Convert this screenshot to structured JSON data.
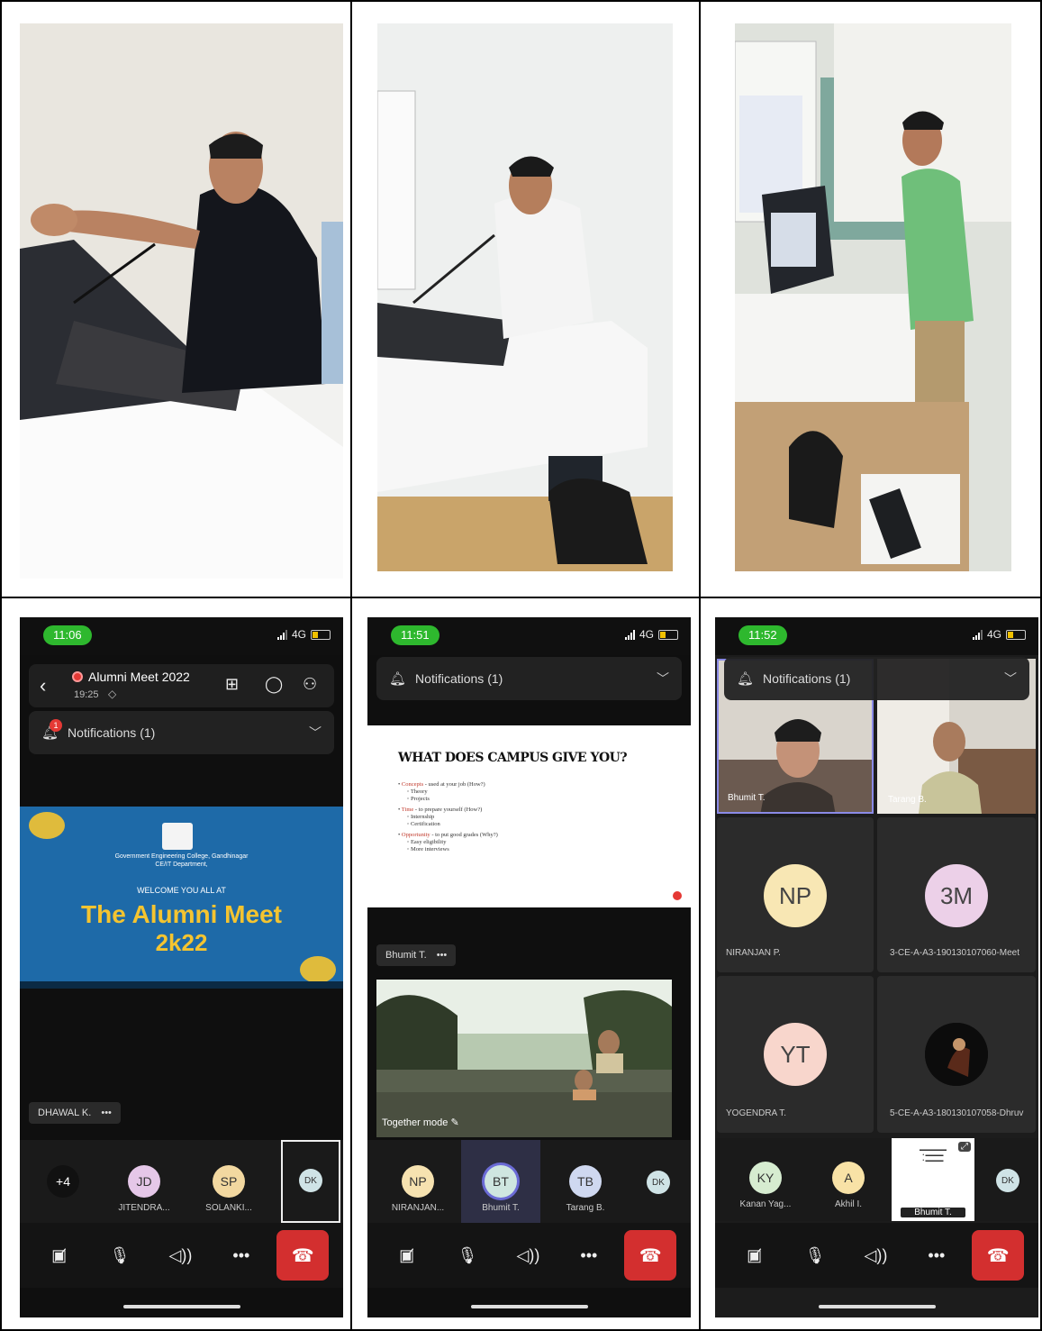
{
  "phones": {
    "p1": {
      "time": "11:06",
      "network": "4G",
      "meeting_title": "Alumni Meet 2022",
      "meeting_duration": "19:25",
      "notifications": "Notifications (1)",
      "notif_count": "1",
      "banner": {
        "college": "Government Engineering College, Gandhinagar",
        "dept": "CE/IT Department,",
        "welcome": "WELCOME YOU ALL AT",
        "title": "The Alumni Meet",
        "year": "2k22"
      },
      "speaker_tag": "DHAWAL K.",
      "more": "•••",
      "participants": [
        {
          "initials": "+4",
          "name": ""
        },
        {
          "initials": "JD",
          "name": "JITENDRA..."
        },
        {
          "initials": "SP",
          "name": "SOLANKI..."
        },
        {
          "initials": "DK",
          "name": ""
        }
      ]
    },
    "p2": {
      "time": "11:51",
      "network": "4G",
      "notifications": "Notifications (1)",
      "slide": {
        "heading": "WHAT DOES CAMPUS GIVE YOU?",
        "items": [
          {
            "key": "Concepts",
            "text": " - used at your job (How?)",
            "subs": [
              "Theory",
              "Projects"
            ]
          },
          {
            "key": "Time",
            "text": " - to prepare yourself (How?)",
            "subs": [
              "Internship",
              "Certification"
            ]
          },
          {
            "key": "Opportunity",
            "text": " - to put good grades (Why?)",
            "subs": [
              "Easy eligibility",
              "More interviews"
            ]
          }
        ]
      },
      "speaker_tag": "Bhumit T.",
      "more": "•••",
      "together_mode": "Together mode",
      "participants": [
        {
          "initials": "NP",
          "name": "NIRANJAN..."
        },
        {
          "initials": "BT",
          "name": "Bhumit T."
        },
        {
          "initials": "TB",
          "name": "Tarang B."
        },
        {
          "initials": "DK",
          "name": ""
        }
      ]
    },
    "p3": {
      "time": "11:52",
      "network": "4G",
      "notifications": "Notifications (1)",
      "video_tiles": [
        {
          "name": "Bhumit T."
        },
        {
          "name": "Tarang B."
        }
      ],
      "tiles": [
        {
          "initials": "NP",
          "name": "NIRANJAN P."
        },
        {
          "initials": "3M",
          "name": "3-CE-A-A3-190130107060-Meet"
        },
        {
          "initials": "YT",
          "name": "YOGENDRA T."
        },
        {
          "initials": "",
          "name": "5-CE-A-A3-180130107058-Dhruv"
        }
      ],
      "participants": [
        {
          "initials": "KY",
          "name": "Kanan Yag..."
        },
        {
          "initials": "A",
          "name": "Akhil I."
        },
        {
          "initials": "",
          "name": "Bhumit T."
        },
        {
          "initials": "DK",
          "name": ""
        }
      ]
    }
  },
  "colors": {
    "end_call": "#d32f2f",
    "time_pill": "#2eb82e",
    "banner_bg": "#1e6aa8",
    "banner_title": "#f4c430"
  }
}
